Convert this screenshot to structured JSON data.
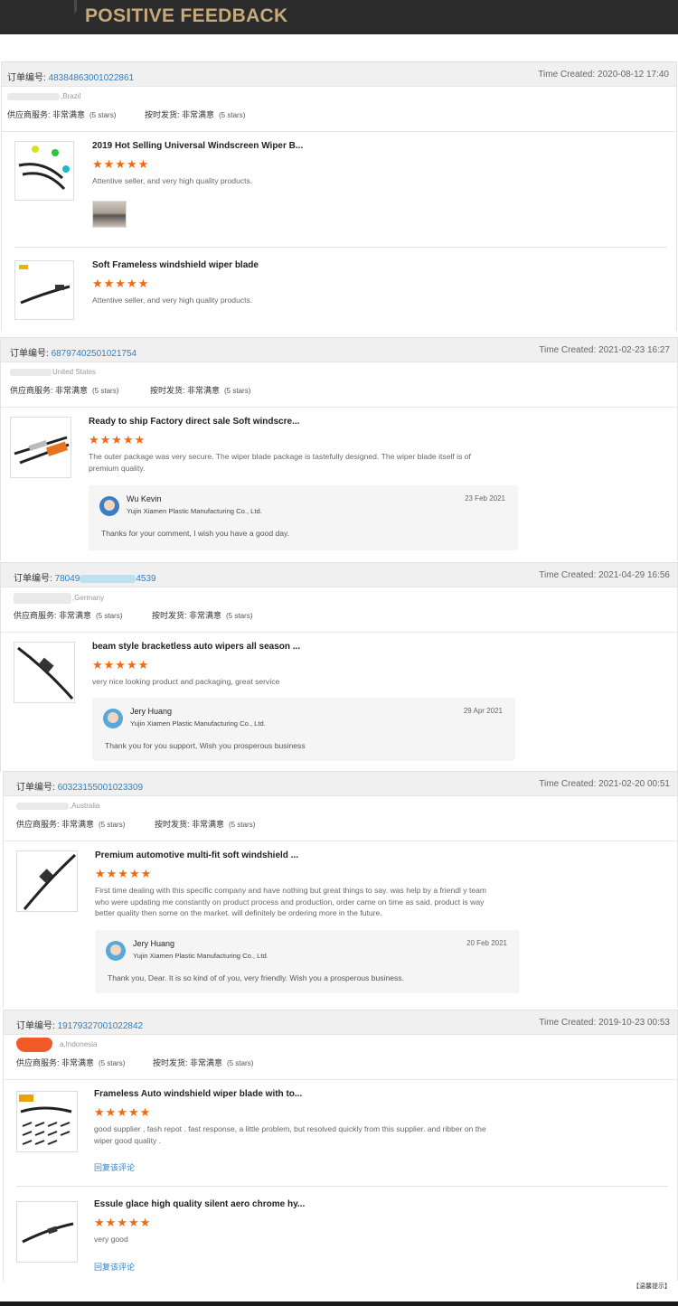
{
  "banner": {
    "title": "POSITIVE FEEDBACK"
  },
  "labels": {
    "order": "订单编号: ",
    "supplier_service": "供应商服务: 非常满意",
    "on_time": "按时发货: 非常满意",
    "rating_note": "(5 stars)"
  },
  "stars": "★★★★★",
  "blocks": [
    {
      "order_number": "48384863001022861",
      "time": "Time Created: 2020-08-12 17:40",
      "country": ",Brazil",
      "items": [
        {
          "title": "2019 Hot Selling Universal Windscreen Wiper B...",
          "comment": "Attentive seller, and very high quality products."
        },
        {
          "title": "Soft Frameless windshield wiper blade",
          "comment": "Attentive seller, and very high quality products."
        }
      ]
    },
    {
      "order_number": "68797402501021754",
      "time": "Time Created: 2021-02-23 16:27",
      "country": "United States",
      "items": [
        {
          "title": "Ready to ship Factory direct sale Soft windscre...",
          "comment": "The outer package was very secure.  The wiper blade package is tastefully designed.  The wiper blade itself is of premium quality."
        }
      ],
      "reply": {
        "name": "Wu Kevin",
        "company": "Yujin Xiamen Plastic Manufacturing Co., Ltd.",
        "date": "23 Feb 2021",
        "text": "Thanks for your comment, I wish you have a good day."
      }
    },
    {
      "order_number_start": "78049",
      "order_number_end": "4539",
      "time": "Time Created: 2021-04-29 16:56",
      "country": ",Germany",
      "items": [
        {
          "title": "beam style bracketless auto wipers all season ...",
          "comment": "very nice looking product and packaging, great service"
        }
      ],
      "reply": {
        "name": "Jery Huang",
        "company": "Yujin Xiamen Plastic Manufacturing Co., Ltd.",
        "date": "29 Apr 2021",
        "text": "Thank you for you support, Wish you prosperous business"
      }
    },
    {
      "order_number": "60323155001023309",
      "time": "Time Created: 2021-02-20 00:51",
      "country": ",Australia",
      "items": [
        {
          "title": "Premium automotive multi-fit soft windshield ...",
          "comment": "First time dealing with this specific company and have nothing but great things to say. was help by a friendl y team who were updating me constantly on product process and production, order came on time as said, product is way better quality then some on the market. will definitely be ordering more in the future."
        }
      ],
      "reply": {
        "name": "Jery Huang",
        "company": "Yujin Xiamen Plastic Manufacturing Co., Ltd.",
        "date": "20 Feb 2021",
        "text": "Thank you, Dear. It is so kind of of you, very friendly. Wish  you a prosperous business."
      }
    },
    {
      "order_number": "19179327001022842",
      "time": "Time Created: 2019-10-23 00:53",
      "country": "a,Indonesia",
      "items": [
        {
          "title": "Frameless Auto windshield wiper blade with to...",
          "comment": "good supplier , fash repot . fast response, a little problem, but resolved quickly from this supplier. and ribber on the wiper good quality .",
          "link": "回复该评论"
        },
        {
          "title": "Essule glace high quality silent aero chrome hy...",
          "comment": "very good",
          "link": "回复该评论"
        }
      ]
    }
  ],
  "footnote": "【温馨提示】"
}
